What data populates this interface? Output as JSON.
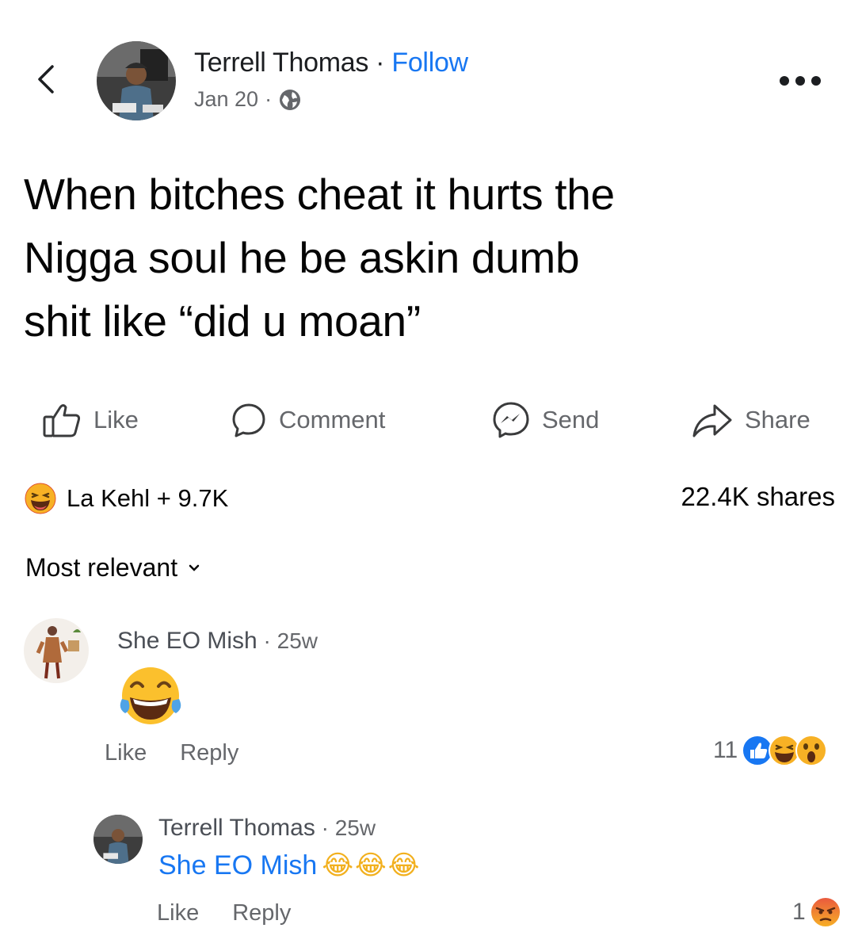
{
  "header": {
    "author": "Terrell Thomas",
    "separator": " · ",
    "follow_label": "Follow",
    "date": "Jan 20",
    "date_separator": "·",
    "audience_icon": "globe-icon"
  },
  "post": {
    "text_lines": [
      "When bitches cheat it hurts the",
      "Nigga soul he be askin dumb",
      "shit like “did u moan”"
    ]
  },
  "actions": {
    "like": "Like",
    "comment": "Comment",
    "send": "Send",
    "share": "Share"
  },
  "stats": {
    "reactors": "La Kehl + 9.7K",
    "shares": "22.4K shares"
  },
  "comments_sort": "Most relevant",
  "comments": [
    {
      "author": "She EO Mish",
      "meta": " · 25w",
      "content_emoji": "😂",
      "like_label": "Like",
      "reply_label": "Reply",
      "reaction_count": "11"
    },
    {
      "author": "Terrell Thomas",
      "meta": " · 25w",
      "mention": "She EO Mish",
      "content_emoji": "😂😂😂",
      "like_label": "Like",
      "reply_label": "Reply",
      "reaction_count": "1"
    }
  ],
  "colors": {
    "link_blue": "#1877f2",
    "secondary_text": "#65676b",
    "primary_text": "#050505"
  }
}
